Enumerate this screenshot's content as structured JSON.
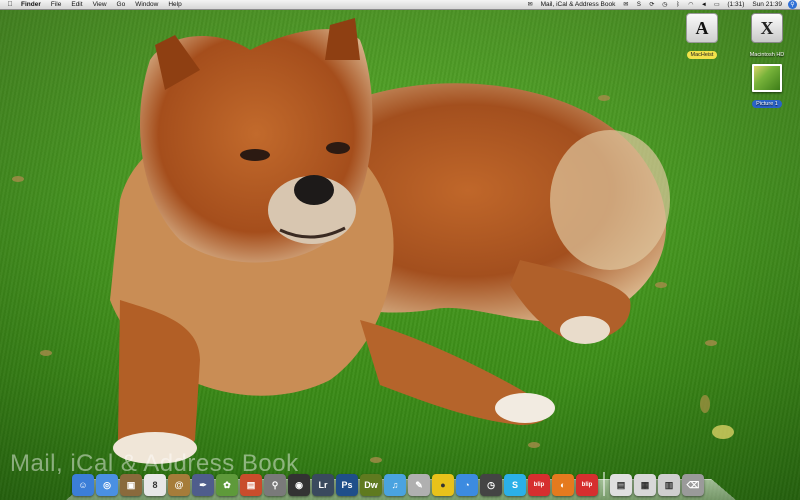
{
  "menubar": {
    "apple_icon": "apple-icon",
    "app_name": "Finder",
    "menus": [
      "File",
      "Edit",
      "View",
      "Go",
      "Window",
      "Help"
    ],
    "status_title": "Mail, iCal & Address Book",
    "battery": "(1:31)",
    "clock": "Sun 21:39"
  },
  "desktop": {
    "icons": [
      {
        "label": "MacHeist",
        "glyph": "A"
      },
      {
        "label": "Macintosh HD",
        "glyph": "X"
      },
      {
        "label": "Picture 1",
        "glyph": ""
      }
    ],
    "watermark": "Mail, iCal & Address Book"
  },
  "dock": {
    "items": [
      {
        "name": "finder-icon",
        "glyph": "☺",
        "color": "#3b7ed8"
      },
      {
        "name": "safari-icon",
        "glyph": "◎",
        "color": "#4a90e2"
      },
      {
        "name": "iphoto-icon",
        "glyph": "▣",
        "color": "#8a6a3c"
      },
      {
        "name": "ical-icon",
        "glyph": "8",
        "color": "#e7e7e7"
      },
      {
        "name": "address-book-icon",
        "glyph": "@",
        "color": "#a67c3a"
      },
      {
        "name": "mail-icon",
        "glyph": "✒",
        "color": "#4f5d8c"
      },
      {
        "name": "photo-app-icon",
        "glyph": "✿",
        "color": "#5e9a3a"
      },
      {
        "name": "media-icon",
        "glyph": "▤",
        "color": "#c94d2c"
      },
      {
        "name": "preview-icon",
        "glyph": "⚲",
        "color": "#7a7a7a"
      },
      {
        "name": "camera-icon",
        "glyph": "◉",
        "color": "#333333"
      },
      {
        "name": "lightroom-icon",
        "glyph": "Lr",
        "color": "#3a4a5e"
      },
      {
        "name": "photoshop-icon",
        "glyph": "Ps",
        "color": "#1f4f8a"
      },
      {
        "name": "dreamweaver-icon",
        "glyph": "Dw",
        "color": "#5f7a1f"
      },
      {
        "name": "itunes-icon",
        "glyph": "♫",
        "color": "#4aa3e0"
      },
      {
        "name": "script-icon",
        "glyph": "✎",
        "color": "#b0b0b0"
      },
      {
        "name": "cyberduck-icon",
        "glyph": "●",
        "color": "#e8c21a"
      },
      {
        "name": "ichat-icon",
        "glyph": "◔",
        "color": "#3c8be0"
      },
      {
        "name": "time-machine-icon",
        "glyph": "◷",
        "color": "#444444"
      },
      {
        "name": "skype-icon",
        "glyph": "S",
        "color": "#2bb0e8"
      },
      {
        "name": "blip-icon",
        "glyph": "blip",
        "color": "#d62f2f"
      },
      {
        "name": "firefox-icon",
        "glyph": "◐",
        "color": "#e57a1e"
      },
      {
        "name": "blip-2-icon",
        "glyph": "blip",
        "color": "#d62f2f"
      },
      {
        "name": "document-icon",
        "glyph": "▤",
        "color": "#e0e0e0"
      },
      {
        "name": "documents-stack-icon",
        "glyph": "▦",
        "color": "#d8d8d8"
      },
      {
        "name": "downloads-stack-icon",
        "glyph": "▥",
        "color": "#cfcfcf"
      },
      {
        "name": "trash-icon",
        "glyph": "⌫",
        "color": "#9a9a9a"
      }
    ]
  }
}
